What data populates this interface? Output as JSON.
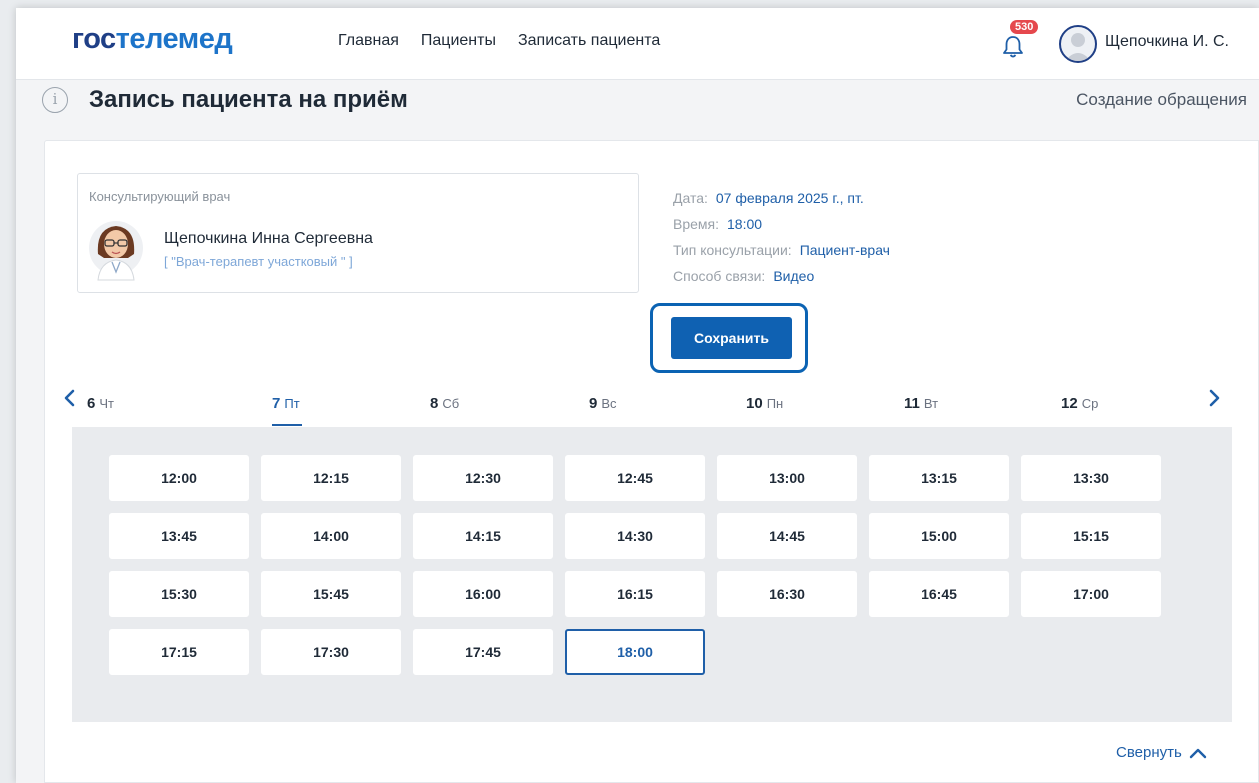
{
  "app": {
    "logo_part1": "гос",
    "logo_part2": "телемед"
  },
  "nav": [
    "Главная",
    "Пациенты",
    "Записать пациента"
  ],
  "notifications": {
    "count": "530",
    "icon": "bell-icon"
  },
  "user": {
    "name": "Щепочкина И. С."
  },
  "page": {
    "title": "Запись пациента на приём",
    "crumb": "Создание обращения"
  },
  "doctor": {
    "caption": "Консультирующий врач",
    "name": "Щепочкина Инна Сергеевна",
    "role": "[ \"Врач-терапевт участковый \" ]"
  },
  "details": {
    "date_label": "Дата:",
    "date_value": "07 февраля 2025 г., пт.",
    "time_label": "Время:",
    "time_value": "18:00",
    "type_label": "Тип консультации:",
    "type_value": "Пациент-врач",
    "comm_label": "Способ связи:",
    "comm_value": "Видео"
  },
  "save_label": "Сохранить",
  "days": [
    {
      "num": "6",
      "name": "Чт"
    },
    {
      "num": "7",
      "name": "Пт",
      "active": true
    },
    {
      "num": "8",
      "name": "Сб"
    },
    {
      "num": "9",
      "name": "Вс"
    },
    {
      "num": "10",
      "name": "Пн"
    },
    {
      "num": "11",
      "name": "Вт"
    },
    {
      "num": "12",
      "name": "Ср"
    }
  ],
  "slots": [
    "12:00",
    "12:15",
    "12:30",
    "12:45",
    "13:00",
    "13:15",
    "13:30",
    "13:45",
    "14:00",
    "14:15",
    "14:30",
    "14:45",
    "15:00",
    "15:15",
    "15:30",
    "15:45",
    "16:00",
    "16:15",
    "16:30",
    "16:45",
    "17:00",
    "17:15",
    "17:30",
    "17:45",
    "18:00"
  ],
  "selected_slot": "18:00",
  "collapse_label": "Свернуть",
  "colors": {
    "brand_dark": "#1f3f86",
    "brand_light": "#1d74c9",
    "accent": "#1f5fa8",
    "badge": "#e5484d"
  }
}
